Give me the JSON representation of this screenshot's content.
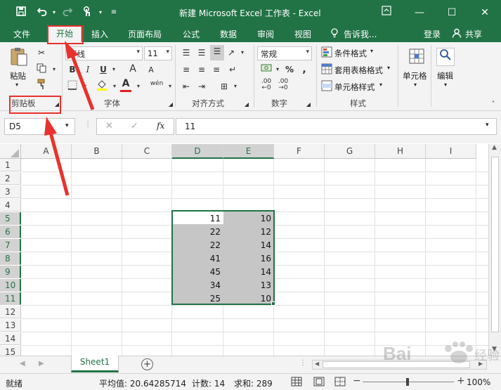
{
  "title": "新建 Microsoft Excel 工作表 - Excel",
  "quick_access": {
    "save": "save-icon",
    "undo": "undo-icon",
    "redo": "redo-icon",
    "touch": "touch-mode-icon"
  },
  "window": {
    "ribbon_options": "ribbon-display-icon",
    "minimize": "—",
    "maximize": "☐",
    "close": "✕"
  },
  "menu": {
    "file": "文件",
    "home": "开始",
    "insert": "插入",
    "layout": "页面布局",
    "formulas": "公式",
    "data": "数据",
    "review": "审阅",
    "view": "视图",
    "tell_me": "告诉我...",
    "login": "登录",
    "share": "共享"
  },
  "ribbon": {
    "clipboard": {
      "paste": "粘贴",
      "group": "剪贴板"
    },
    "font": {
      "name": "等线",
      "size": "11",
      "bold": "B",
      "italic": "I",
      "underline": "U",
      "grow": "A",
      "shrink": "A",
      "font_color": "A",
      "wen": "wén",
      "group": "字体"
    },
    "alignment": {
      "group": "对齐方式"
    },
    "number": {
      "format": "常规",
      "percent": "%",
      "comma": ",",
      "inc": ".00",
      "dec": ".00",
      "group": "数字"
    },
    "styles": {
      "conditional": "条件格式",
      "table": "套用表格格式",
      "cell_styles": "单元格样式",
      "group": "样式"
    },
    "cells": {
      "label": "单元格"
    },
    "editing": {
      "label": "编辑"
    }
  },
  "formula_bar": {
    "name_box": "D5",
    "cancel": "✕",
    "enter": "✓",
    "fx": "fx",
    "value": "11"
  },
  "columns": [
    "A",
    "B",
    "C",
    "D",
    "E",
    "F",
    "G",
    "H",
    "I"
  ],
  "rows": [
    "1",
    "2",
    "3",
    "4",
    "5",
    "6",
    "7",
    "8",
    "9",
    "10",
    "11",
    "12",
    "13",
    "14",
    "15"
  ],
  "cells": {
    "D": [
      "11",
      "22",
      "22",
      "41",
      "45",
      "34",
      "25"
    ],
    "E": [
      "10",
      "12",
      "14",
      "16",
      "14",
      "13",
      "10"
    ]
  },
  "sheet_tab": "Sheet1",
  "add_sheet": "+",
  "status": {
    "ready": "就绪",
    "average": "平均值: 20.64285714",
    "count": "计数: 14",
    "sum": "求和: 289",
    "zoom": "100%"
  },
  "colors": {
    "brand": "#217346",
    "annotation": "#e8322d",
    "selection_fill": "#c6c6c6"
  }
}
